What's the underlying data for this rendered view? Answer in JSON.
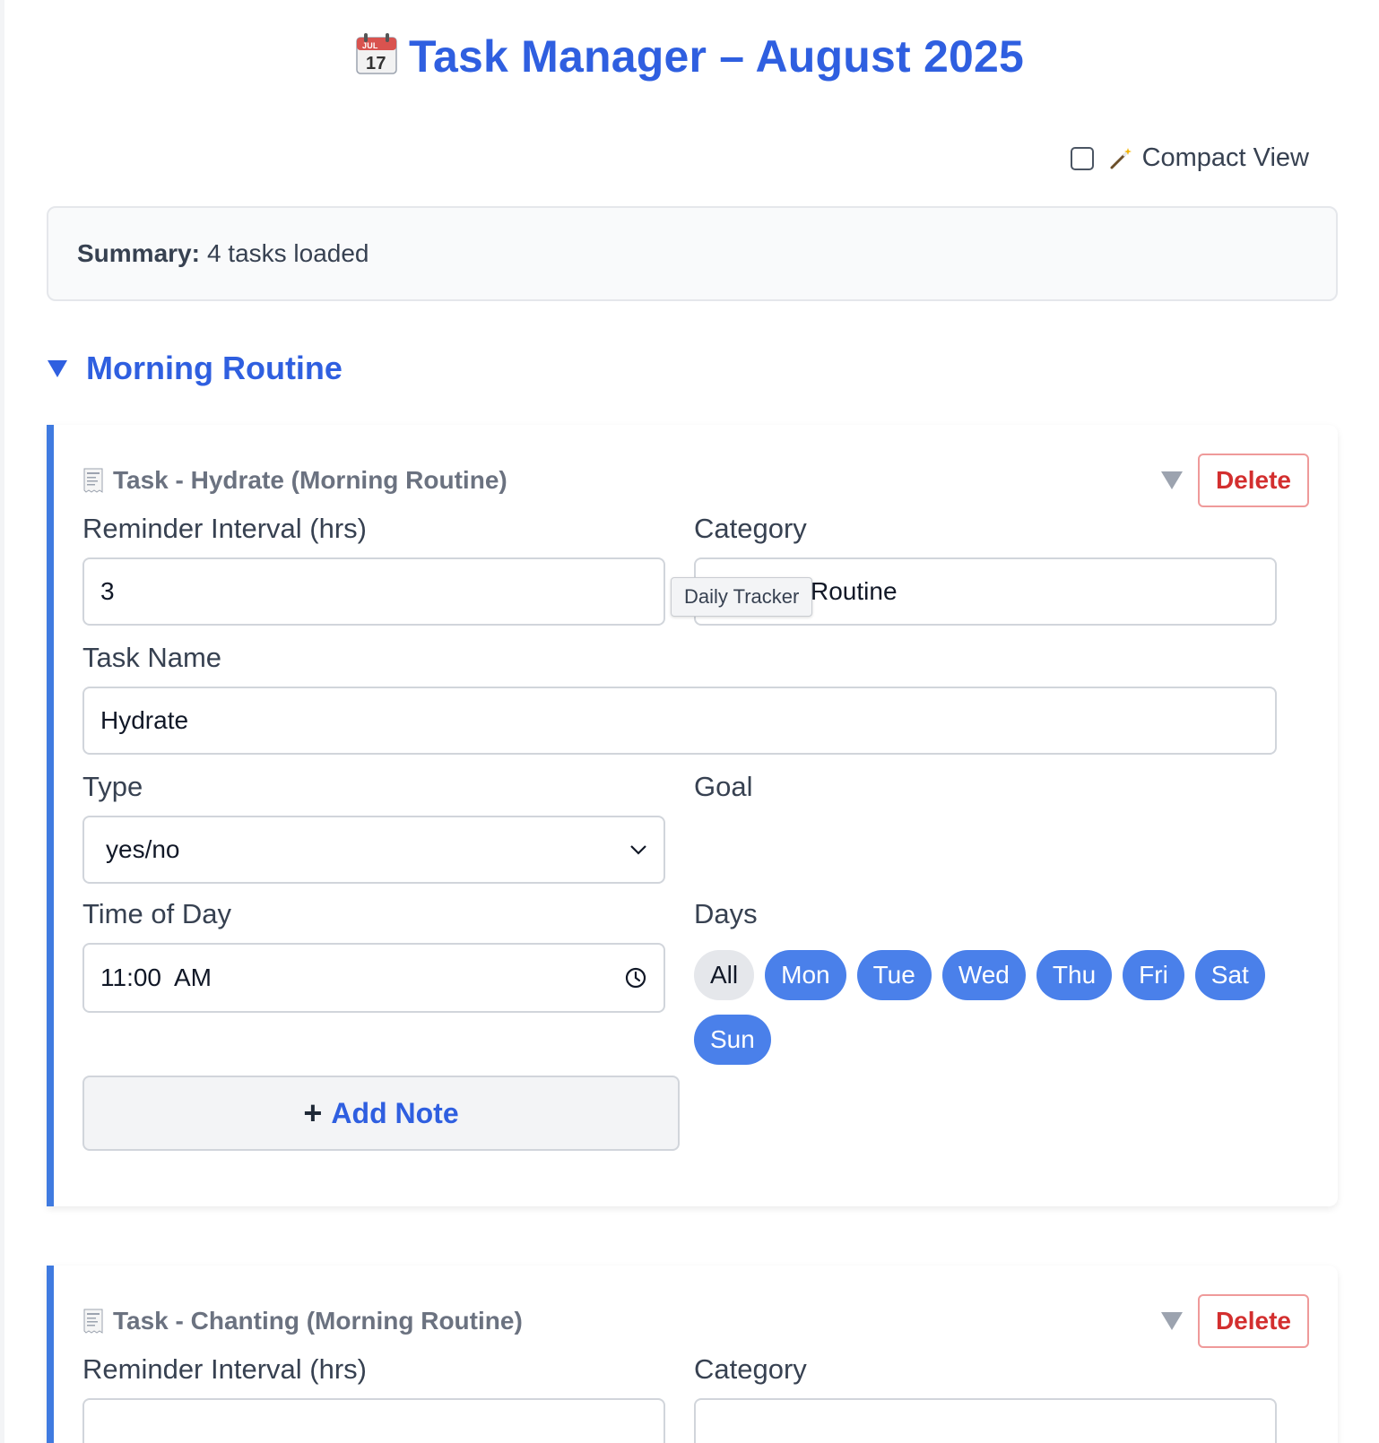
{
  "page": {
    "title": "Task Manager – August 2025",
    "calendar_icon": "calendar-icon",
    "calendar_month": "JUL",
    "calendar_day": "17"
  },
  "compact_view": {
    "label": "Compact View",
    "checked": false,
    "icon": "magic-wand-icon"
  },
  "summary": {
    "label": "Summary:",
    "text": "4 tasks loaded"
  },
  "group": {
    "name": "Morning Routine",
    "expanded": true
  },
  "tasks": [
    {
      "title": "Task - Hydrate (Morning Routine)",
      "delete_label": "Delete",
      "reminder_label": "Reminder Interval (hrs)",
      "reminder_value": "3",
      "category_label": "Category",
      "category_value_visible": "Routine",
      "tooltip": "Daily Tracker",
      "name_label": "Task Name",
      "name_value": "Hydrate",
      "type_label": "Type",
      "type_value": "yes/no",
      "goal_label": "Goal",
      "time_label": "Time of Day",
      "time_value": "11:00  AM",
      "days_label": "Days",
      "days": [
        {
          "label": "All",
          "selected": false
        },
        {
          "label": "Mon",
          "selected": true
        },
        {
          "label": "Tue",
          "selected": true
        },
        {
          "label": "Wed",
          "selected": true
        },
        {
          "label": "Thu",
          "selected": true
        },
        {
          "label": "Fri",
          "selected": true
        },
        {
          "label": "Sat",
          "selected": true
        },
        {
          "label": "Sun",
          "selected": true
        }
      ],
      "add_note_plus": "+",
      "add_note_label": "Add Note"
    },
    {
      "title": "Task - Chanting (Morning Routine)",
      "delete_label": "Delete",
      "reminder_label": "Reminder Interval (hrs)",
      "category_label": "Category"
    }
  ],
  "colors": {
    "accent": "#2f5fe0",
    "pill_on": "#4a80ea",
    "delete": "#d32f2f",
    "card_border": "#3f7ae0"
  }
}
